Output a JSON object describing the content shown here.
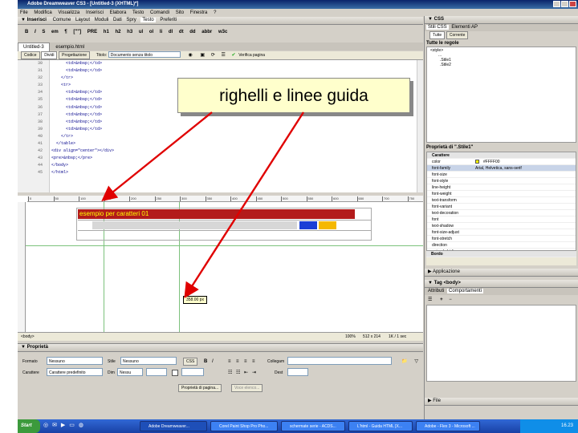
{
  "window": {
    "title": "Adobe Dreamweaver CS3 - [Untitled-3 (XHTML)*]"
  },
  "menu": [
    "File",
    "Modifica",
    "Visualizza",
    "Inserisci",
    "Elabora",
    "Testo",
    "Comandi",
    "Sito",
    "Finestra",
    "?"
  ],
  "insert_bar": {
    "title": "▼ Inserisci",
    "tabs": [
      "Comune",
      "Layout",
      "Moduli",
      "Dati",
      "Spry",
      "Testo",
      "Preferiti"
    ],
    "tools": [
      "B",
      "I",
      "S",
      "em",
      "¶",
      "[\"\"]",
      "PRE",
      "h1",
      "h2",
      "h3",
      "ul",
      "ol",
      "li",
      "dl",
      "dt",
      "dd",
      "abbr",
      "w3c"
    ]
  },
  "doc_tabs": [
    "Untitled-3",
    "esempio.html"
  ],
  "doc_toolbar": {
    "codice": "Codice",
    "dividi": "Dividi",
    "progettazione": "Progettazione",
    "titolo_label": "Titolo:",
    "titolo_value": "Documento senza titolo",
    "verifica": "Verifica pagina"
  },
  "code_lines": [
    {
      "n": "30",
      "t": "      <td>&nbsp;</td>"
    },
    {
      "n": "31",
      "t": "      <td>&nbsp;</td>"
    },
    {
      "n": "32",
      "t": "    </tr>"
    },
    {
      "n": "33",
      "t": "    <tr>"
    },
    {
      "n": "34",
      "t": "      <td>&nbsp;</td>"
    },
    {
      "n": "35",
      "t": "      <td>&nbsp;</td>"
    },
    {
      "n": "36",
      "t": "      <td>&nbsp;</td>"
    },
    {
      "n": "37",
      "t": "      <td>&nbsp;</td>"
    },
    {
      "n": "38",
      "t": "      <td>&nbsp;</td>"
    },
    {
      "n": "39",
      "t": "      <td>&nbsp;</td>"
    },
    {
      "n": "40",
      "t": "    </tr>"
    },
    {
      "n": "41",
      "t": "  </table>"
    },
    {
      "n": "42",
      "t": "<div align=\"center\"></div>"
    },
    {
      "n": "43",
      "t": "<pre>&nbsp;</pre>"
    },
    {
      "n": "44",
      "t": "</body>"
    },
    {
      "n": "45",
      "t": "</html>"
    }
  ],
  "ruler_ticks": [
    "0",
    "50",
    "100",
    "150",
    "200",
    "250",
    "300",
    "350",
    "400",
    "450",
    "500",
    "550",
    "600",
    "650",
    "700",
    "750"
  ],
  "design": {
    "header_text": "esempio per caratteri 01",
    "guide_tooltip": "358.00 px",
    "colors": {
      "header": "#b31b1b",
      "blue": "#1a3fd6",
      "orange": "#f5b800",
      "guide": "#7cc27c"
    }
  },
  "status_bar": {
    "tag": "<body>",
    "zoom": "100%",
    "size": "512 x 214",
    "info": "1K / 1 sec"
  },
  "properties": {
    "title": "▼ Proprietà",
    "formato_label": "Formato",
    "formato_value": "Nessuno",
    "stile_label": "Stile",
    "stile_value": "Nessuno",
    "css_btn": "CSS",
    "collegam_label": "Collegam",
    "carattere_label": "Carattere",
    "carattere_value": "Carattere predefinito",
    "dim_label": "Dim",
    "dim_value": "Nessu",
    "dest_label": "Dest",
    "page_props": "Proprietà di pagina...",
    "list_item": "Voce elenco..."
  },
  "css_panel": {
    "title": "▼ CSS",
    "tabs": [
      "Stili CSS",
      "Elementi AP"
    ],
    "sub_tabs": [
      "Tutte",
      "Corrente"
    ],
    "rules_label": "Tutte le regole",
    "tree": [
      "<style>",
      "...",
      ".Stile1",
      ".Stile2"
    ],
    "props_title": "Proprietà di \".Stile1\"",
    "group": "Carattere",
    "color_value": "#FFFF00",
    "font_value": "Arial, Helvetica, sans-serif",
    "props": [
      "color",
      "font-family",
      "font-size",
      "font-style",
      "line-height",
      "font-weight",
      "text-transform",
      "font-variant",
      "text-decoration",
      "font",
      "text-shadow",
      "font-size-adjust",
      "font-stretch",
      "direction",
      "unicode-bidi"
    ],
    "bordo": "Bordo"
  },
  "app_panel": "▶ Applicazione",
  "tag_panel": {
    "title": "▼ Tag <body>",
    "tabs": [
      "Attributi",
      "Comportamenti"
    ]
  },
  "files_panel": "▶ File",
  "callout": {
    "text": "righelli e linee guida"
  },
  "taskbar": {
    "start": "Start",
    "tasks": [
      "Adobe Dreamweaver...",
      "Corel Paint Shop Pro Pho...",
      "schermate serie - ACDS...",
      "L'html - Guida HTML [X...",
      "Adobe - Flex 3 - Microsoft ..."
    ],
    "clock": "16.23"
  }
}
